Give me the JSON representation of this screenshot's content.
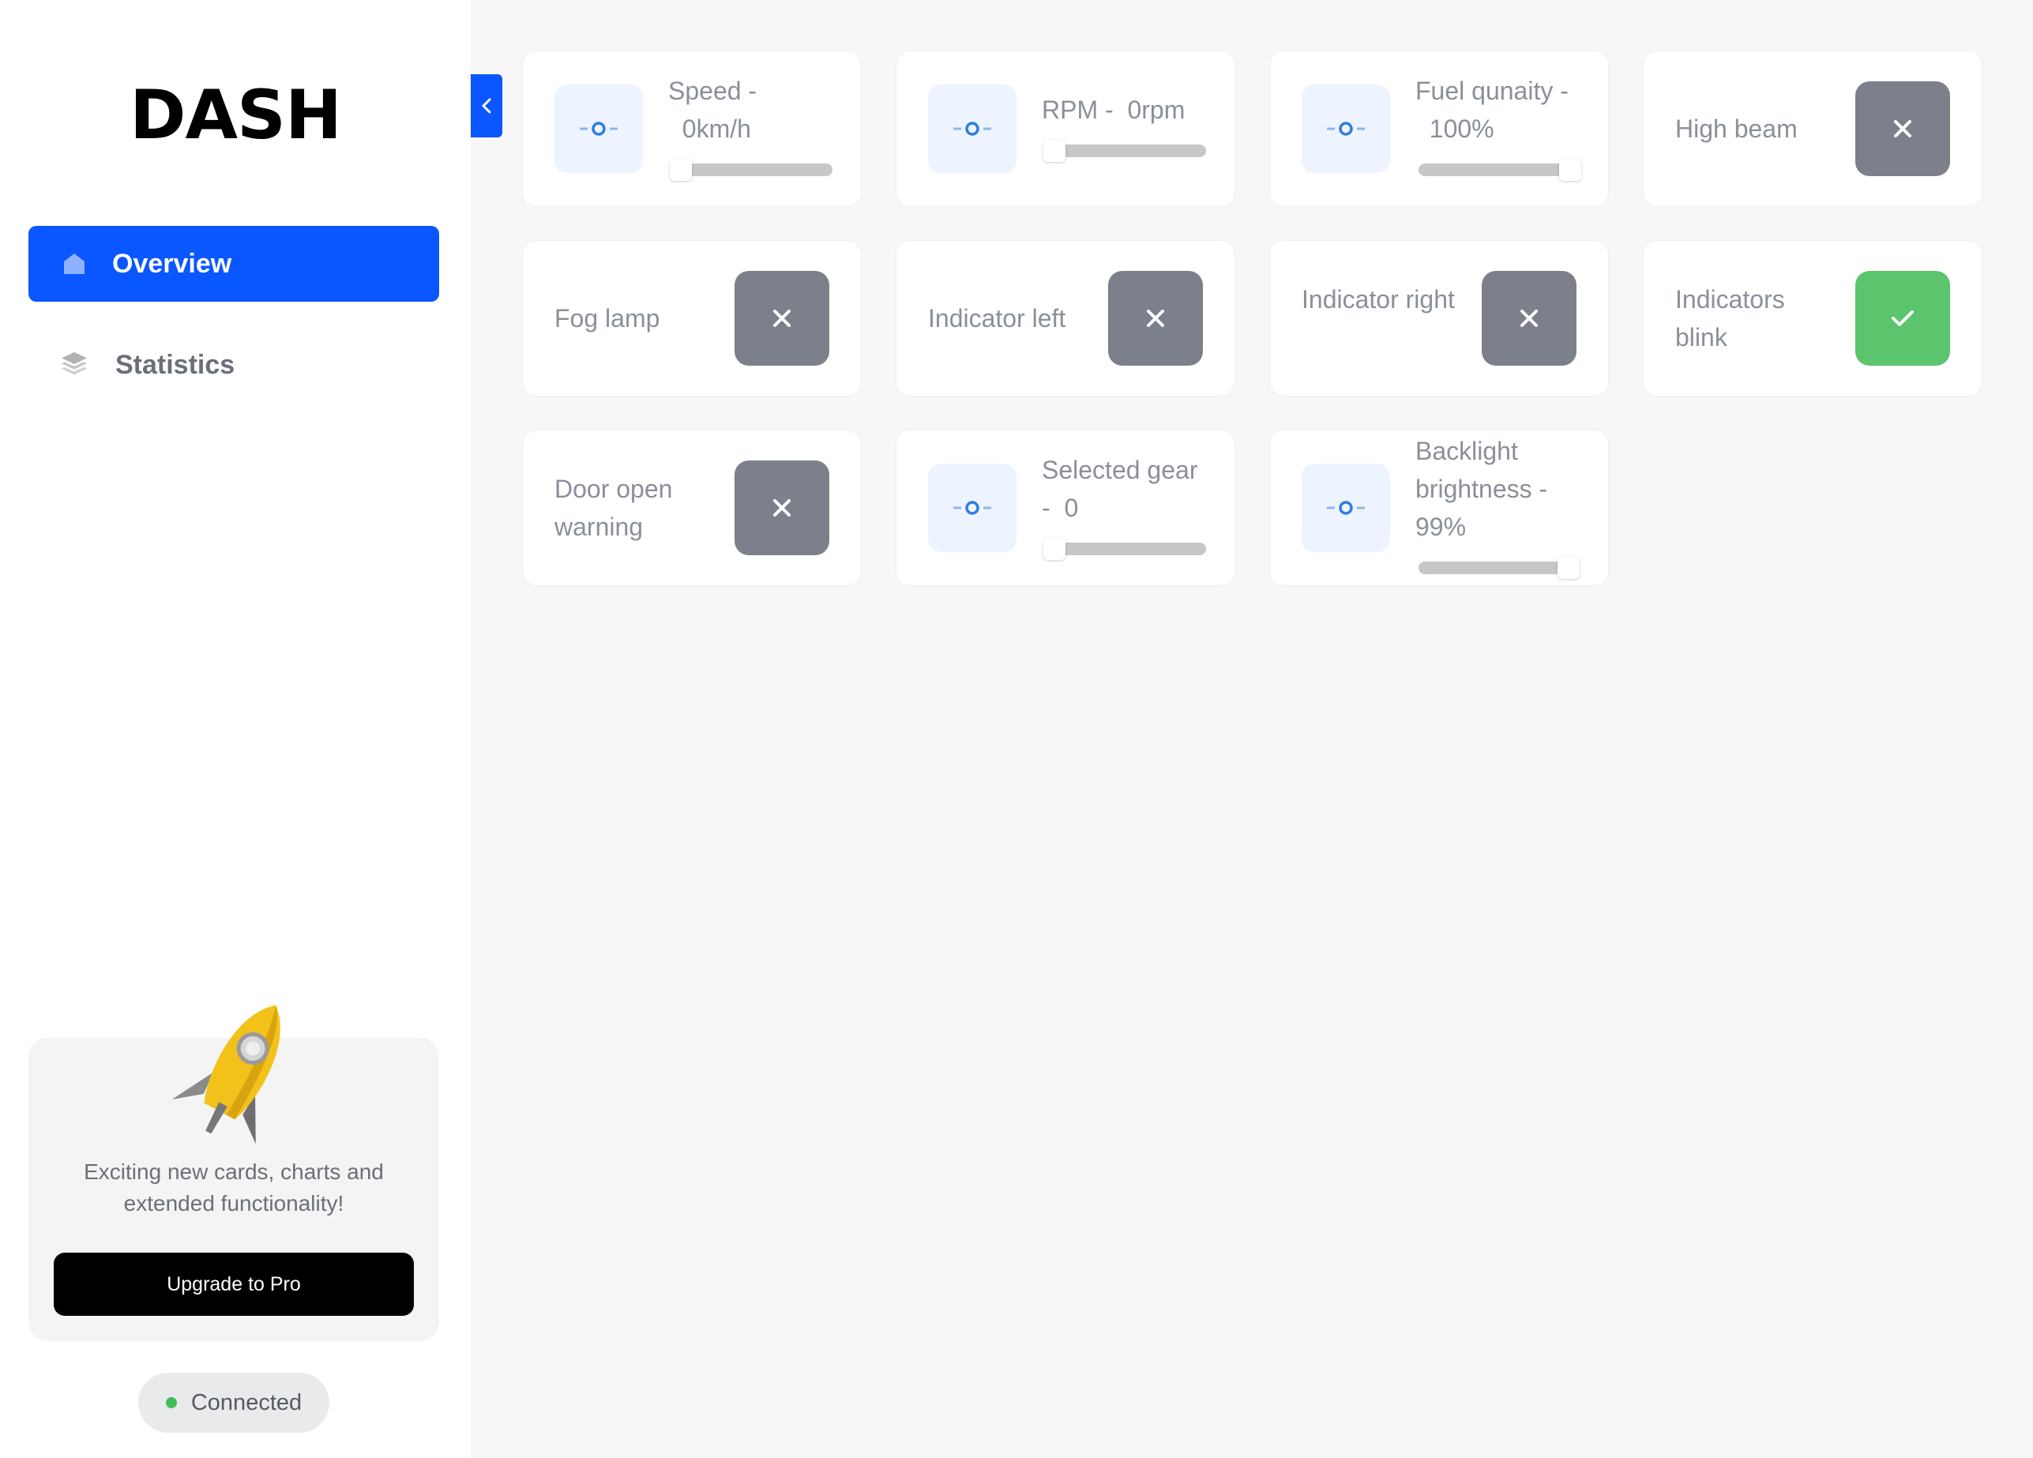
{
  "app": {
    "logo": "DASH"
  },
  "sidebar": {
    "items": [
      {
        "label": "Overview",
        "icon": "home-icon",
        "active": true
      },
      {
        "label": "Statistics",
        "icon": "layers-icon",
        "active": false
      }
    ],
    "promo": {
      "text": "Exciting new cards, charts and extended functionality!",
      "button_label": "Upgrade to Pro",
      "image": "rocket-illustration"
    },
    "status": {
      "label": "Connected",
      "color": "#3fbf56"
    }
  },
  "colors": {
    "accent": "#0a57ff",
    "toggle_off": "#7b808a",
    "toggle_on": "#5bc46d",
    "slider_icon_bg": "#edf4ff"
  },
  "cards": {
    "speed": {
      "title": "Speed -  0km/h",
      "value_fraction": 0.0,
      "icon": "slider-icon"
    },
    "rpm": {
      "title": "RPM -  0rpm",
      "value_fraction": 0.0,
      "icon": "slider-icon"
    },
    "fuel": {
      "title": "Fuel qunaity -  100%",
      "value_fraction": 1.0,
      "icon": "slider-icon"
    },
    "high_beam": {
      "label": "High beam",
      "state": "off",
      "icon": "close-icon"
    },
    "fog_lamp": {
      "label": "Fog lamp",
      "state": "off",
      "icon": "close-icon"
    },
    "indicator_left": {
      "label": "Indicator left",
      "state": "off",
      "icon": "close-icon"
    },
    "indicator_right": {
      "label": "Indicator right",
      "state": "off",
      "icon": "close-icon"
    },
    "indicators_blink": {
      "label": "Indicators blink",
      "state": "on",
      "icon": "check-icon"
    },
    "door_open": {
      "label": "Door open warning",
      "state": "off",
      "icon": "close-icon"
    },
    "gear": {
      "title": "Selected gear -  0",
      "value_fraction": 0.0,
      "icon": "slider-icon"
    },
    "backlight": {
      "title": "Backlight brightness - 99%",
      "value_fraction": 0.99,
      "icon": "slider-icon"
    }
  }
}
